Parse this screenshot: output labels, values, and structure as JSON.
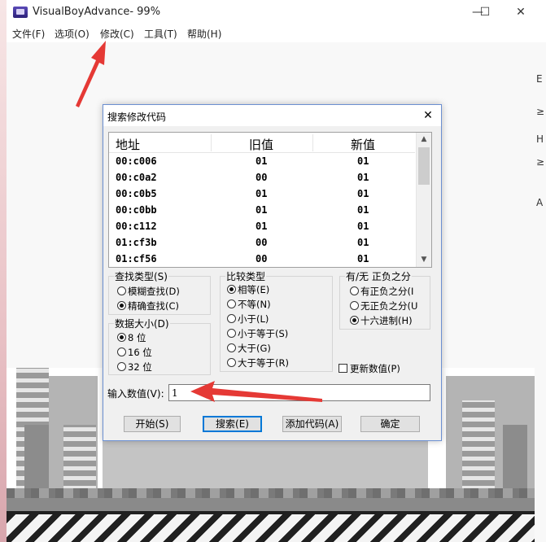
{
  "window": {
    "title": "VisualBoyAdvance- 99%",
    "minimize": "—",
    "maximize": "☐",
    "close": "✕"
  },
  "menu": [
    "文件(F)",
    "选项(O)",
    "修改(C)",
    "工具(T)",
    "帮助(H)"
  ],
  "right_edge_glyphs": [
    "E",
    "≥",
    "H",
    "≥",
    "A"
  ],
  "dialog": {
    "title": "搜索修改代码",
    "close": "✕",
    "columns": [
      "地址",
      "旧值",
      "新值"
    ],
    "rows": [
      {
        "addr": "00:c006",
        "old": "01",
        "new": "01"
      },
      {
        "addr": "00:c0a2",
        "old": "00",
        "new": "01"
      },
      {
        "addr": "00:c0b5",
        "old": "01",
        "new": "01"
      },
      {
        "addr": "00:c0bb",
        "old": "01",
        "new": "01"
      },
      {
        "addr": "00:c112",
        "old": "01",
        "new": "01"
      },
      {
        "addr": "01:cf3b",
        "old": "00",
        "new": "01"
      },
      {
        "addr": "01:cf56",
        "old": "00",
        "new": "01"
      }
    ],
    "scroll_up": "▲",
    "scroll_down": "▼",
    "search_type": {
      "title": "查找类型(S)",
      "options": [
        "模糊查找(D)",
        "精确查找(C)"
      ],
      "selected": 1
    },
    "data_size": {
      "title": "数据大小(D)",
      "options": [
        "8 位",
        "16 位",
        "32 位"
      ],
      "selected": 0
    },
    "compare_type": {
      "title": "比较类型",
      "options": [
        "相等(E)",
        "不等(N)",
        "小于(L)",
        "小于等于(S)",
        "大于(G)",
        "大于等于(R)"
      ],
      "selected": 0
    },
    "sign": {
      "title": "有/无 正负之分",
      "options": [
        "有正负之分(I",
        "无正负之分(U",
        "十六进制(H)"
      ],
      "selected": 2
    },
    "update_values": "更新数值(P)",
    "input_label": "输入数值(V):",
    "input_value": "1",
    "buttons": {
      "start": "开始(S)",
      "search": "搜索(E)",
      "add_code": "添加代码(A)",
      "ok": "确定"
    }
  },
  "annotation_color": "#e53935"
}
